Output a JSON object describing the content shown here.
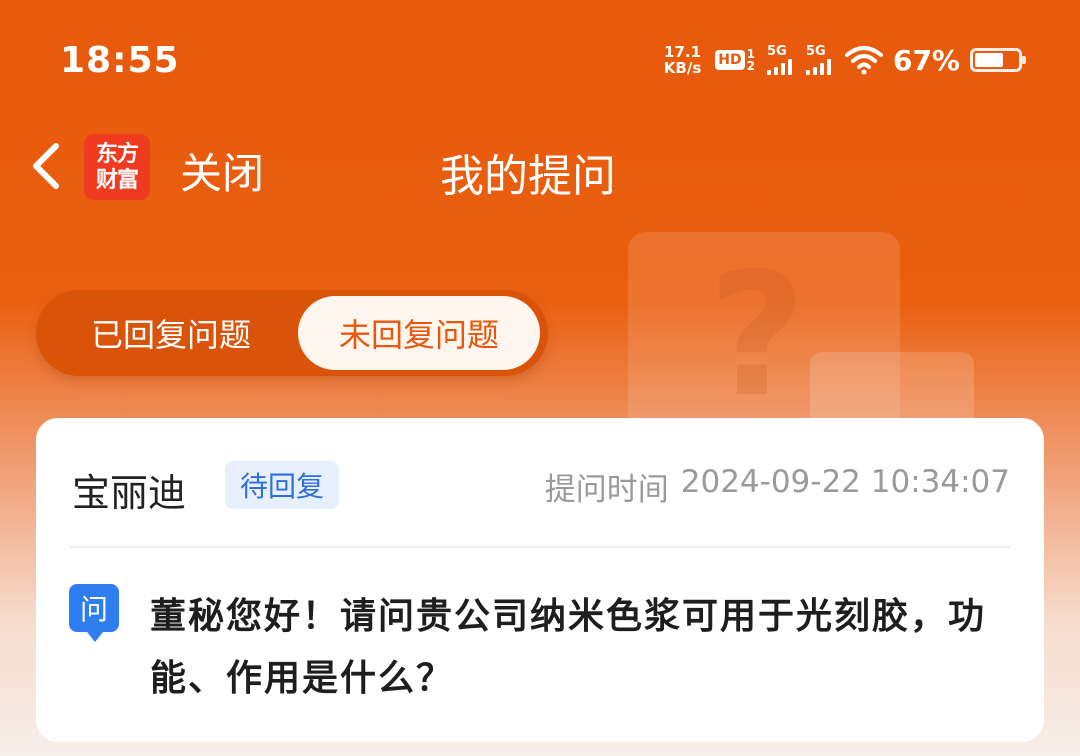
{
  "status_bar": {
    "time": "18:55",
    "net_speed_value": "17.1",
    "net_speed_unit": "KB/s",
    "hd_label": "HD",
    "hd_sub_top": "1",
    "hd_sub_bottom": "2",
    "signal1_label": "5G",
    "signal2_label": "5G",
    "battery_percent": "67%",
    "battery_level": 0.67
  },
  "nav": {
    "logo_line1": "东方",
    "logo_line2": "财富",
    "close_label": "关闭",
    "title": "我的提问"
  },
  "decoration": {
    "glyph": "?"
  },
  "tabs": [
    {
      "label": "已回复问题",
      "active": false
    },
    {
      "label": "未回复问题",
      "active": true
    }
  ],
  "question_card": {
    "company": "宝丽迪",
    "status": "待回复",
    "time_label": "提问时间",
    "time_value": "2024-09-22 10:34:07",
    "question_icon_label": "问",
    "question_text": "董秘您好！请问贵公司纳米色浆可用于光刻胶，功能、作用是什么？"
  },
  "colors": {
    "brand_orange": "#e85a0c",
    "badge_blue": "#2f6fd8",
    "logo_red": "#ef3b1f"
  }
}
